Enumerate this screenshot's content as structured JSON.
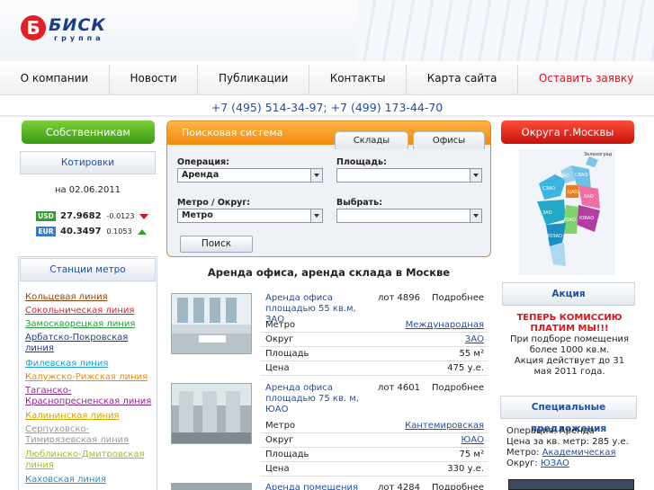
{
  "brand": {
    "logo_letter": "Б",
    "name": "БИСК",
    "sub": "группа"
  },
  "nav": [
    {
      "label": "О компании"
    },
    {
      "label": "Новости"
    },
    {
      "label": "Публикации"
    },
    {
      "label": "Контакты"
    },
    {
      "label": "Карта сайта"
    },
    {
      "label": "Оставить заявку"
    }
  ],
  "phones": "+7 (495) 514-34-97; +7 (499) 173-44-70",
  "owners_button": "Собственникам",
  "districts_button": "Округа г.Москвы",
  "quotes": {
    "title": "Котировки",
    "date": "на 02.06.2011",
    "items": [
      {
        "tag": "USD",
        "rate": "27.9682",
        "change": "-0.0123",
        "color": "#2ea02e",
        "trend": "down"
      },
      {
        "tag": "EUR",
        "rate": "40.3497",
        "change": "0.1053",
        "color": "#3a7bc8",
        "trend": "up"
      }
    ]
  },
  "metro": {
    "title": "Станции метро",
    "lines": [
      {
        "label": "Кольцевая линия",
        "color": "#8b4513"
      },
      {
        "label": "Сокольническая линия",
        "color": "#e31e24"
      },
      {
        "label": "Замоскворецкая линия",
        "color": "#2a9d3a"
      },
      {
        "label": "Арбатско-Покровская линия",
        "color": "#1c3f95"
      },
      {
        "label": "Филевская линия",
        "color": "#1e9fd6"
      },
      {
        "label": "Калужско-Рижская линия",
        "color": "#f08a00"
      },
      {
        "label": "Таганско-Краснопресненская линия",
        "color": "#8b2a8b"
      },
      {
        "label": "Калининская линия",
        "color": "#d4a400"
      },
      {
        "label": "Серпуховско-Тимирязевская линия",
        "color": "#9a9a9a"
      },
      {
        "label": "Люблинско-Дмитровская линия",
        "color": "#9ac31c"
      },
      {
        "label": "Каховская линия",
        "color": "#2a8fbf"
      }
    ]
  },
  "search": {
    "title": "Поисковая система",
    "tabs": [
      "Склады",
      "Офисы"
    ],
    "operation_label": "Операция:",
    "operation_value": "Аренда",
    "area_label": "Площадь:",
    "area_value": "",
    "metro_label": "Метро / Округ:",
    "metro_value": "Метро",
    "choose_label": "Выбрать:",
    "choose_value": "",
    "button": "Поиск"
  },
  "main_title": "Аренда офиса, аренда склада в Москве",
  "listings": [
    {
      "title": "Аренда офиса площадью 55 кв.м, ЗАО",
      "id": "лот 4896",
      "more": "Подробнее",
      "rows": [
        {
          "k": "Метро",
          "v": "Международная",
          "link": true
        },
        {
          "k": "Округ",
          "v": "ЗАО",
          "link": true
        },
        {
          "k": "Площадь",
          "v": "55 м²",
          "link": false
        },
        {
          "k": "Цена",
          "v": "475 у.е.",
          "link": false
        }
      ]
    },
    {
      "title": "Аренда офиса площадью 75 кв. м, ЮАО",
      "id": "лот 4601",
      "more": "Подробнее",
      "rows": [
        {
          "k": "Метро",
          "v": "Кантемировская",
          "link": true
        },
        {
          "k": "Округ",
          "v": "ЮАО",
          "link": true
        },
        {
          "k": "Площадь",
          "v": "75 м²",
          "link": false
        },
        {
          "k": "Цена",
          "v": "330 у.е.",
          "link": false
        }
      ]
    },
    {
      "title": "Аренда помещения под",
      "id": "лот 4284",
      "more": "Подробнее",
      "rows": []
    }
  ],
  "map": {
    "label_top": "Зеленоград",
    "districts": [
      "САО",
      "СВАО",
      "ЦАО",
      "ВАО",
      "ЗАО",
      "ЮВАО",
      "ЮАО",
      "ЮЗАО",
      "СЗАО"
    ]
  },
  "akcia": {
    "title": "Акция",
    "headline_1": "ТЕПЕРЬ КОМИССИЮ",
    "headline_2": "ПЛАТИМ МЫ!!!",
    "text_1": "При подборе помещения",
    "text_2": "более 1000 кв.м.",
    "text_3": "Акция действует до 31",
    "text_4": "мая 2011 года."
  },
  "special": {
    "title": "Специальные предложения",
    "operation": "Операция: Аренда",
    "price": "Цена за кв. метр: 285 у.е.",
    "metro_prefix": "Метро: ",
    "metro": "Академическая",
    "district_prefix": "Округ: ",
    "district": "ЮЗАО"
  }
}
